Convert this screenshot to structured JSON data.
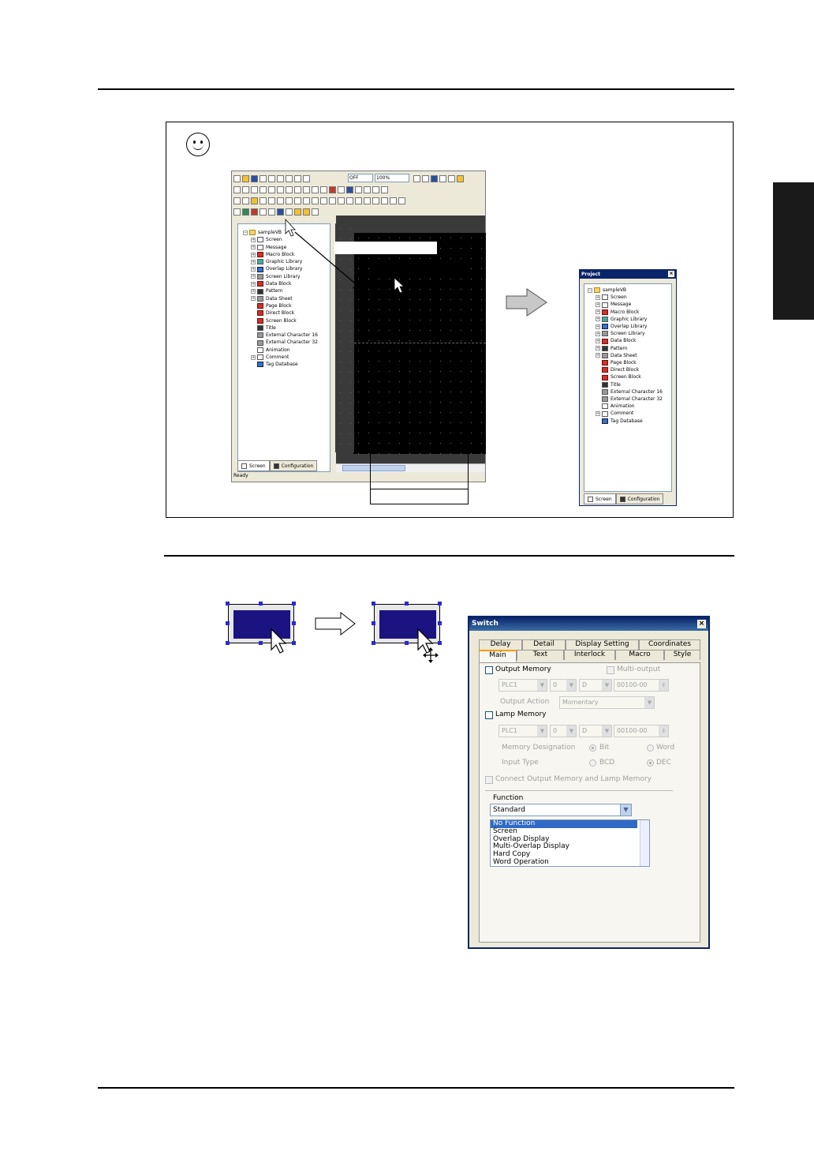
{
  "sidebar_tab": {
    "color": "#1a1a1a"
  },
  "app": {
    "toolbar": {
      "display_off": "OFF",
      "zoom": "100%"
    },
    "tree": {
      "root": "sampleVB",
      "items": [
        "Screen",
        "Message",
        "Macro Block",
        "Graphic Library",
        "Overlap Library",
        "Screen Library",
        "Data Block",
        "Pattern",
        "Data Sheet",
        "Page Block",
        "Direct Block",
        "Screen Block",
        "Title",
        "External Character 16",
        "External Character 32",
        "Animation",
        "Comment",
        "Tag Database"
      ]
    },
    "panel_tabs": [
      "Screen",
      "Configuration"
    ],
    "status": "Ready"
  },
  "project_window": {
    "title": "Project",
    "root": "sampleVB",
    "items": [
      "Screen",
      "Message",
      "Macro Block",
      "Graphic Library",
      "Overlap Library",
      "Screen Library",
      "Data Block",
      "Pattern",
      "Data Sheet",
      "Page Block",
      "Direct Block",
      "Screen Block",
      "Title",
      "External Character 16",
      "External Character 32",
      "Animation",
      "Comment",
      "Tag Database"
    ],
    "tabs": [
      "Screen",
      "Configuration"
    ]
  },
  "switch_dialog": {
    "title": "Switch",
    "tabs_back": [
      "Delay",
      "Detail",
      "Display Setting",
      "Coordinates"
    ],
    "tabs_front": [
      "Main",
      "Text",
      "Interlock",
      "Macro",
      "Style"
    ],
    "output_memory": "Output Memory",
    "multi_output": "Multi-output",
    "plc": "PLC1",
    "zero": "0",
    "d": "D",
    "address": "00100-00",
    "output_action_label": "Output Action",
    "output_action_value": "Momentary",
    "lamp_memory": "Lamp Memory",
    "memory_designation": "Memory Designation",
    "bit": "Bit",
    "word": "Word",
    "input_type": "Input Type",
    "bcd": "BCD",
    "dec": "DEC",
    "connect": "Connect Output Memory and Lamp Memory",
    "function_label": "Function",
    "function_value": "Standard",
    "function_list": [
      "No Function",
      "Screen",
      "Overlap Display",
      "Multi-Overlap Display",
      "Hard Copy",
      "Word Operation"
    ]
  },
  "colors": {
    "switch_fill": "#1a1380",
    "handle": "#2a2acf",
    "title_bar": "#0a246a"
  }
}
